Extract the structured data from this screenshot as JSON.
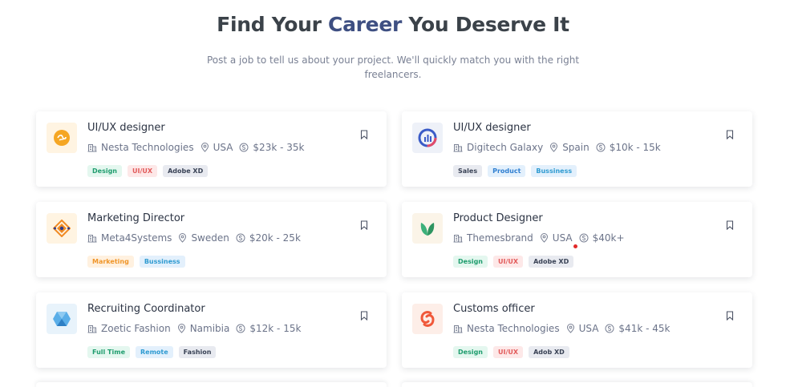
{
  "hero": {
    "title_before": "Find Your ",
    "title_accent": "Career",
    "title_after": " You Deserve It",
    "subtitle": "Post a job to tell us about your project. We'll quickly match you with the right freelancers."
  },
  "colors": {
    "accent": "#3e4f82",
    "tag_green": "#e4f7ef",
    "tag_red": "#fde8e8",
    "tag_blue": "#e3f0fc",
    "tag_gray": "#e8eaf0",
    "tag_orange": "#fff1e0"
  },
  "jobs": [
    {
      "title": "UI/UX designer",
      "company": "Nesta Technologies",
      "location": "USA",
      "salary": "$23k - 35k",
      "logo_icon": "orange-hand-logo-icon",
      "tags": [
        {
          "label": "Design",
          "style": "green"
        },
        {
          "label": "UI/UX",
          "style": "red"
        },
        {
          "label": "Adobe XD",
          "style": "gray"
        }
      ]
    },
    {
      "title": "UI/UX designer",
      "company": "Digitech Galaxy",
      "location": "Spain",
      "salary": "$10k - 15k",
      "logo_icon": "blue-chart-circle-logo-icon",
      "tags": [
        {
          "label": "Sales",
          "style": "gray"
        },
        {
          "label": "Product",
          "style": "blue"
        },
        {
          "label": "Bussiness",
          "style": "blue"
        }
      ]
    },
    {
      "title": "Marketing Director",
      "company": "Meta4Systems",
      "location": "Sweden",
      "salary": "$20k - 25k",
      "logo_icon": "orange-diamond-logo-icon",
      "tags": [
        {
          "label": "Marketing",
          "style": "orange"
        },
        {
          "label": "Bussiness",
          "style": "blue"
        }
      ]
    },
    {
      "title": "Product Designer",
      "company": "Themesbrand",
      "location": "USA",
      "salary": "$40k+",
      "logo_icon": "green-leaf-logo-icon",
      "tags": [
        {
          "label": "Design",
          "style": "green"
        },
        {
          "label": "UI/UX",
          "style": "red"
        },
        {
          "label": "Adobe XD",
          "style": "gray"
        }
      ]
    },
    {
      "title": "Recruiting Coordinator",
      "company": "Zoetic Fashion",
      "location": "Namibia",
      "salary": "$12k - 15k",
      "logo_icon": "blue-cube-logo-icon",
      "tags": [
        {
          "label": "Full Time",
          "style": "green"
        },
        {
          "label": "Remote",
          "style": "blue"
        },
        {
          "label": "Fashion",
          "style": "gray"
        }
      ]
    },
    {
      "title": "Customs officer",
      "company": "Nesta Technologies",
      "location": "USA",
      "salary": "$41k - 45k",
      "logo_icon": "red-swirl-logo-icon",
      "tags": [
        {
          "label": "Design",
          "style": "green"
        },
        {
          "label": "UI/UX",
          "style": "red"
        },
        {
          "label": "Adob XD",
          "style": "gray"
        }
      ]
    }
  ]
}
